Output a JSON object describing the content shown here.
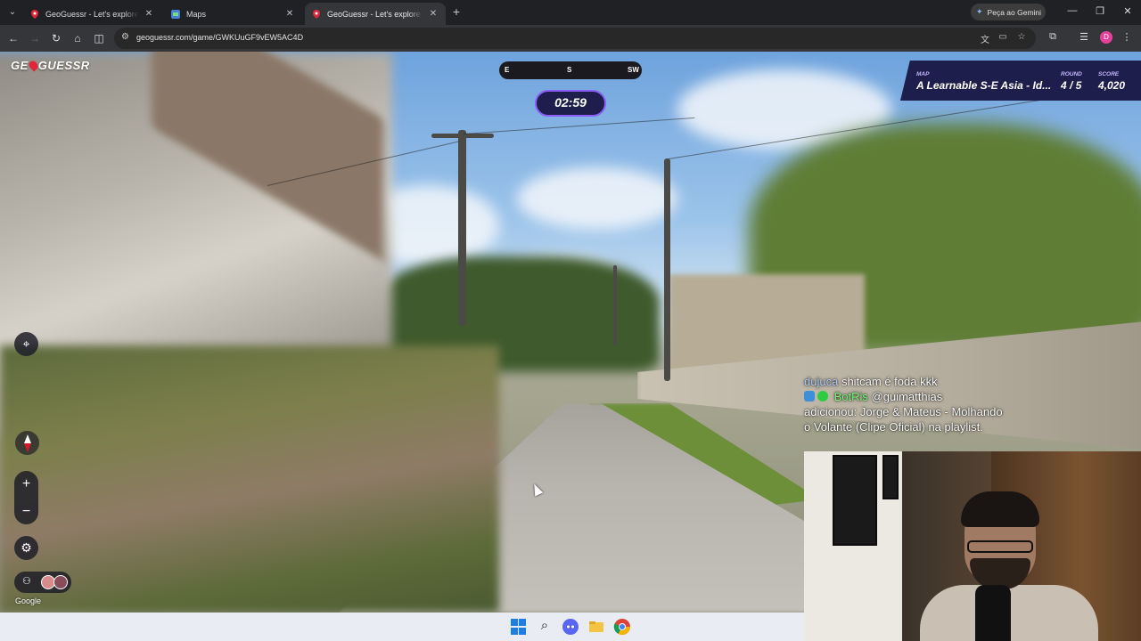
{
  "browser": {
    "tabs": [
      {
        "title": "GeoGuessr - Let's explore the w",
        "favicon": "geoguessr-pin-icon",
        "active": false
      },
      {
        "title": "Maps",
        "favicon": "maps-icon",
        "active": false
      },
      {
        "title": "GeoGuessr - Let's explore the w",
        "favicon": "geoguessr-pin-icon",
        "active": true
      }
    ],
    "gemini_label": "Peça ao Gemini",
    "url": "geoguessr.com/game/GWKUuGF9vEW5AC4D",
    "profile_initial": "D"
  },
  "game": {
    "logo_text_left": "GE",
    "logo_text_right": "GUESSR",
    "compass": {
      "left": "E",
      "center": "S",
      "right": "SW"
    },
    "timer": "02:59",
    "map_label": "MAP",
    "map_name": "A Learnable S-E Asia - Id...",
    "round_label": "ROUND",
    "round_value": "4 / 5",
    "score_label": "SCORE",
    "score_value": "4,020",
    "google_label": "Google"
  },
  "chat": {
    "line1_user": "dujuca",
    "line1_text": "shitcam é foda kkk",
    "line2_user": "BotRis",
    "line2_text": "@guimatthias",
    "line3_text": "adicionou: Jorge & Mateus - Molhando",
    "line4_text": "o Volante (Clipe Oficial) na playlist."
  },
  "colors": {
    "panel_bg": "#1d1e4b",
    "timer_border": "#8b5cf6",
    "accent_purple": "#c4b5fd",
    "brand_red": "#e0263a"
  }
}
